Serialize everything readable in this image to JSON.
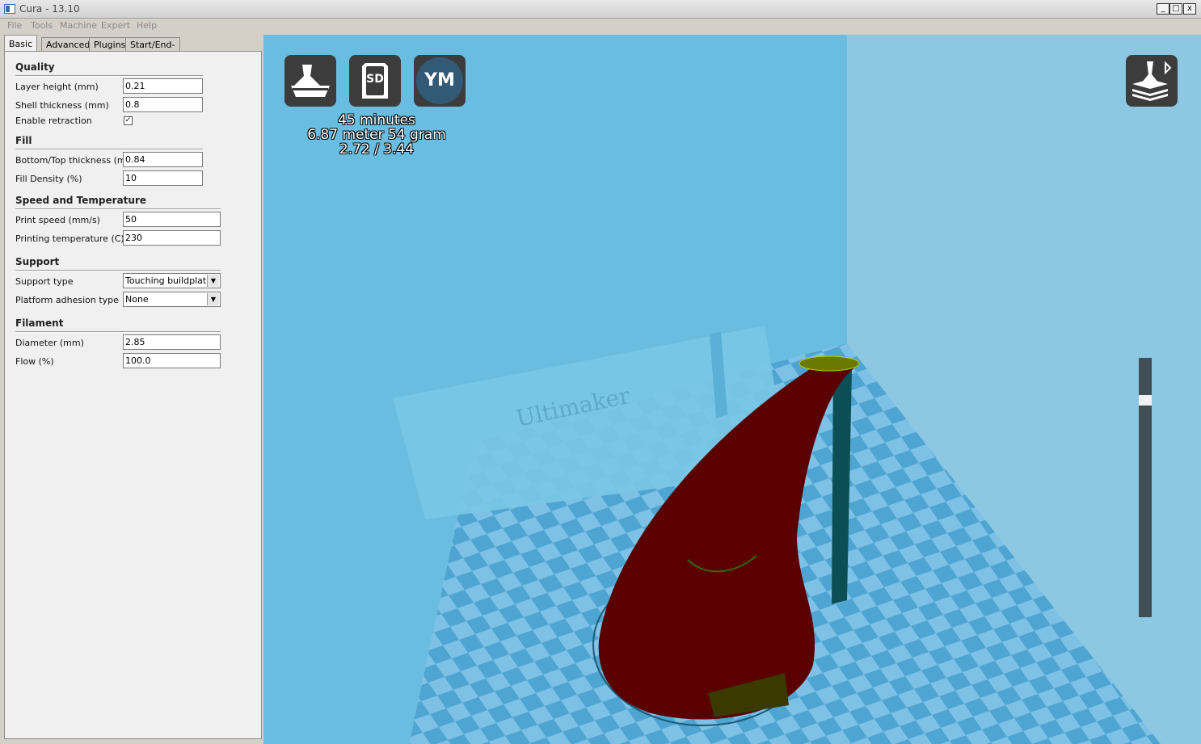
{
  "window": {
    "title": "Cura - 13.10"
  },
  "window_controls": {
    "minimize": "_",
    "maximize": "□",
    "close": "x"
  },
  "menu": [
    "File",
    "Tools",
    "Machine",
    "Expert",
    "Help"
  ],
  "tabs": [
    "Basic",
    "Advanced",
    "Plugins",
    "Start/End-GCode"
  ],
  "quality": {
    "title": "Quality",
    "layer_height_label": "Layer height (mm)",
    "layer_height": "0.21",
    "shell_label": "Shell thickness (mm)",
    "shell": "0.8",
    "retraction_label": "Enable retraction",
    "retraction_check": "✓"
  },
  "fill": {
    "title": "Fill",
    "bottom_top_label": "Bottom/Top thickness (mm)",
    "bottom_top": "0.84",
    "density_label": "Fill Density (%)",
    "density": "10"
  },
  "speed": {
    "title": "Speed and Temperature",
    "speed_label": "Print speed (mm/s)",
    "speed": "50",
    "temp_label": "Printing temperature (C)",
    "temp": "230"
  },
  "support": {
    "title": "Support",
    "type_label": "Support type",
    "type": "Touching buildplate",
    "adhesion_label": "Platform adhesion type",
    "adhesion": "None"
  },
  "filament": {
    "title": "Filament",
    "diameter_label": "Diameter (mm)",
    "diameter": "2.85",
    "flow_label": "Flow (%)",
    "flow": "100.0"
  },
  "viewport": {
    "sd_label": "SD",
    "ym_label": "YM",
    "stats": [
      "45 minutes",
      "6.87 meter 54 gram",
      "2.72 / 3.44"
    ],
    "plate_text": "Ultimaker",
    "layer_slider_value": 0.85
  }
}
